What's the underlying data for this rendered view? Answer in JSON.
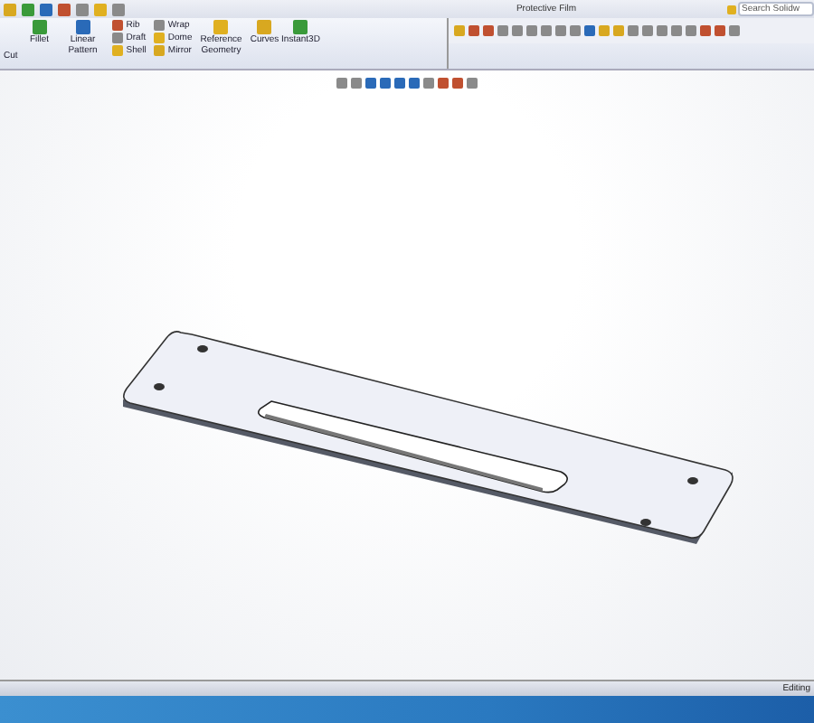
{
  "window": {
    "title": "Protective Film"
  },
  "search": {
    "placeholder": "Search Solidw"
  },
  "ribbon": [
    {
      "kind": "partial",
      "label": "Cut"
    },
    {
      "kind": "large",
      "label": "Fillet"
    },
    {
      "kind": "large",
      "label": "Linear Pattern"
    },
    {
      "kind": "stack",
      "items": [
        "Rib",
        "Draft",
        "Shell"
      ]
    },
    {
      "kind": "stack",
      "items": [
        "Wrap",
        "Dome",
        "Mirror"
      ]
    },
    {
      "kind": "large",
      "label": "Reference Geometry"
    },
    {
      "kind": "large",
      "label": "Curves"
    },
    {
      "kind": "large",
      "label": "Instant3D"
    }
  ],
  "status_bar": {
    "text": "Editing"
  }
}
